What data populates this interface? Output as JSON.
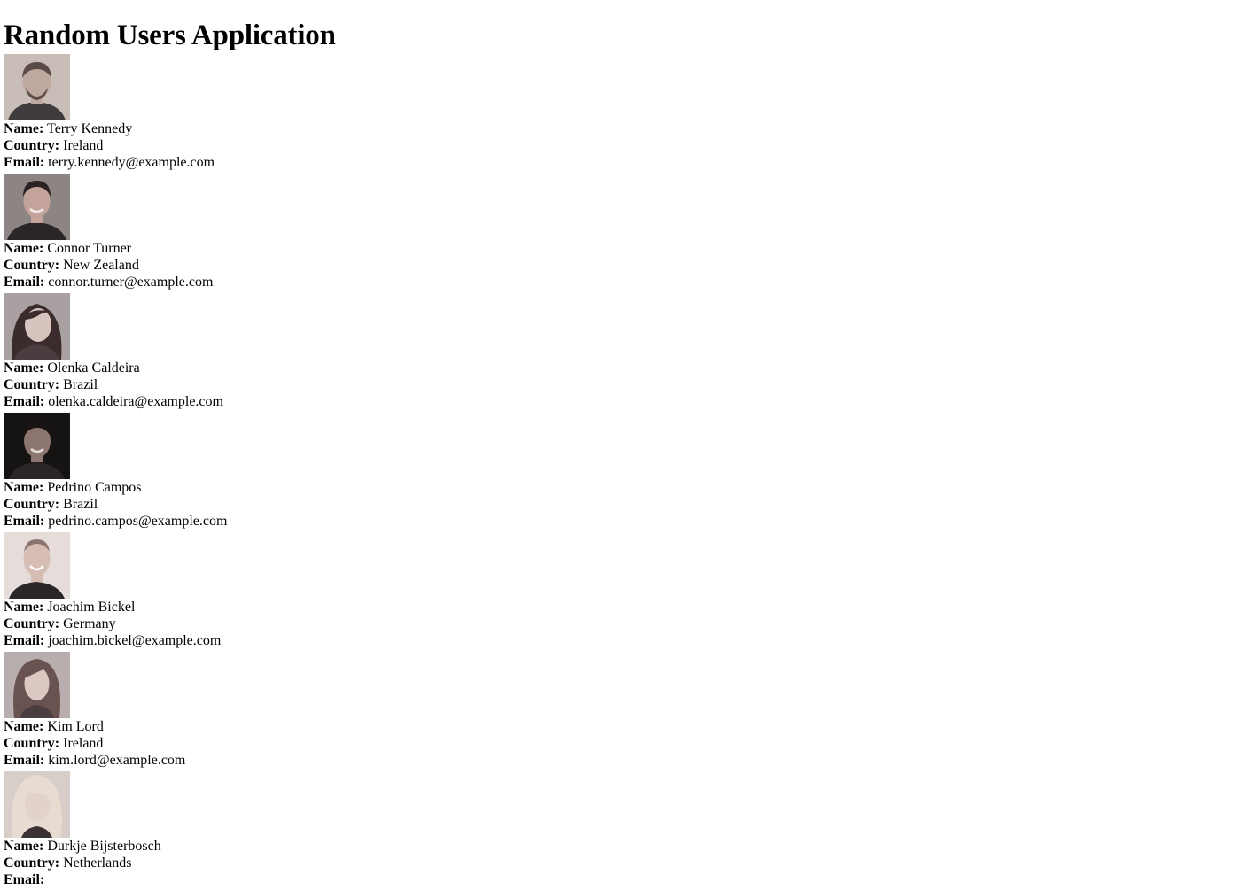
{
  "page": {
    "title": "Random Users Application"
  },
  "labels": {
    "name": "Name:",
    "country": "Country:",
    "email": "Email:"
  },
  "users": [
    {
      "name": "Terry Kennedy",
      "country": "Ireland",
      "email": "terry.kennedy@example.com",
      "photo": {
        "bg": "#c9bdb8",
        "skin": "#bfa89f",
        "hair": "#5b4a45",
        "shirt": "#3f3a3c",
        "icon": "man-portrait-icon"
      }
    },
    {
      "name": "Connor Turner",
      "country": "New Zealand",
      "email": "connor.turner@example.com",
      "photo": {
        "bg": "#8d8583",
        "skin": "#c4a49a",
        "hair": "#2b2224",
        "shirt": "#2a2527",
        "icon": "man-portrait-icon"
      }
    },
    {
      "name": "Olenka Caldeira",
      "country": "Brazil",
      "email": "olenka.caldeira@example.com",
      "photo": {
        "bg": "#a9a0a2",
        "skin": "#d8c4bf",
        "hair": "#3a2b2c",
        "shirt": "#4a3d40",
        "icon": "woman-portrait-icon"
      }
    },
    {
      "name": "Pedrino Campos",
      "country": "Brazil",
      "email": "pedrino.campos@example.com",
      "photo": {
        "bg": "#161313",
        "skin": "#8e7670",
        "hair": "#1a1414",
        "shirt": "#2b2526",
        "icon": "man-portrait-icon"
      }
    },
    {
      "name": "Joachim Bickel",
      "country": "Germany",
      "email": "joachim.bickel@example.com",
      "photo": {
        "bg": "#e6dcda",
        "skin": "#d6bdb4",
        "hair": "#8a7470",
        "shirt": "#2a2527",
        "icon": "man-portrait-icon"
      }
    },
    {
      "name": "Kim Lord",
      "country": "Ireland",
      "email": "kim.lord@example.com",
      "photo": {
        "bg": "#b8aeae",
        "skin": "#dcc8c2",
        "hair": "#6a5250",
        "shirt": "#4a3d40",
        "icon": "woman-portrait-icon"
      }
    },
    {
      "name": "Durkje Bijsterbosch",
      "country": "Netherlands",
      "email": "",
      "photo": {
        "bg": "#d7cdc9",
        "skin": "#e2d2cc",
        "hair": "#e8dcd2",
        "shirt": "#3b3234",
        "icon": "woman-portrait-icon"
      }
    }
  ]
}
